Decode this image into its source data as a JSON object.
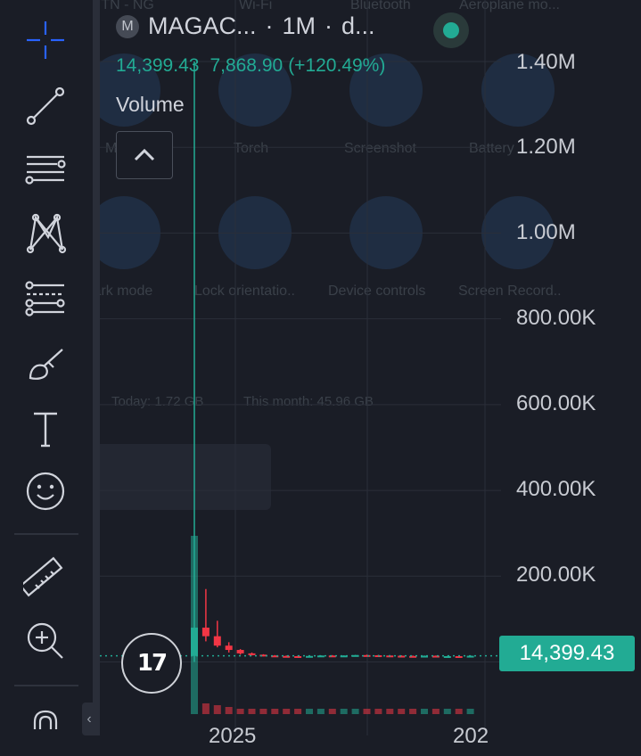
{
  "symbol_badge": "M",
  "title": {
    "symbol": "MAGAC...",
    "interval": "1M",
    "exchange": "d..."
  },
  "ohlc": {
    "last": "14,399.43",
    "change": "7,868.90",
    "change_pct": "(+120.49%)"
  },
  "volume_label": "Volume",
  "collapse_icon": "chevron-up",
  "tools": [
    "crosshair-icon",
    "trend-line-icon",
    "horizontal-lines-icon",
    "pattern-icon",
    "fib-tools-icon",
    "brush-icon",
    "text-icon",
    "emoji-icon",
    "ruler-icon",
    "zoom-in-icon",
    "lock-icon"
  ],
  "colors": {
    "up": "#22ab94",
    "down": "#f23645",
    "background": "#1a1d26",
    "axis_text": "#c8cbd2"
  },
  "price_tag": "14,399.43",
  "logo_text": "17",
  "x_axis_partial": [
    "2025",
    "202"
  ],
  "overlay_text": {
    "top_row": [
      "MTN - NG",
      "Wi-Fi",
      "Bluetooth",
      "Aeroplane mo..."
    ],
    "row1": [
      "Mute",
      "Torch",
      "Screenshot",
      "Battery"
    ],
    "row2": [
      "Dark mode",
      "Lock orientatio..",
      "Device controls",
      "Screen Record.."
    ],
    "usage": [
      "Today: 1.72 GB",
      "This month: 45.96 GB"
    ]
  },
  "chart_data": {
    "type": "candlestick",
    "y_axis": {
      "labels": [
        "1.40M",
        "1.20M",
        "1.00M",
        "800.00K",
        "600.00K",
        "400.00K",
        "200.00K"
      ],
      "ylim": [
        0,
        1400000
      ]
    },
    "last_price": 14399.43,
    "candles": [
      {
        "o": 14000,
        "h": 1400000,
        "l": 0,
        "c": 80000
      },
      {
        "o": 80000,
        "h": 170000,
        "l": 48000,
        "c": 60000
      },
      {
        "o": 60000,
        "h": 96000,
        "l": 34000,
        "c": 38000
      },
      {
        "o": 38000,
        "h": 46000,
        "l": 22000,
        "c": 28000
      },
      {
        "o": 28000,
        "h": 30000,
        "l": 17000,
        "c": 20000
      },
      {
        "o": 20000,
        "h": 22000,
        "l": 15000,
        "c": 17000
      },
      {
        "o": 17000,
        "h": 18000,
        "l": 13000,
        "c": 15000
      },
      {
        "o": 15000,
        "h": 16000,
        "l": 12500,
        "c": 14000
      },
      {
        "o": 14000,
        "h": 15000,
        "l": 12500,
        "c": 13500
      },
      {
        "o": 13500,
        "h": 14500,
        "l": 12500,
        "c": 13000
      },
      {
        "o": 13000,
        "h": 14500,
        "l": 12500,
        "c": 14000
      },
      {
        "o": 14000,
        "h": 15500,
        "l": 13000,
        "c": 15000
      },
      {
        "o": 15000,
        "h": 16000,
        "l": 13500,
        "c": 14500
      },
      {
        "o": 14500,
        "h": 15500,
        "l": 13500,
        "c": 15000
      },
      {
        "o": 15000,
        "h": 16500,
        "l": 14000,
        "c": 16000
      },
      {
        "o": 16000,
        "h": 17000,
        "l": 14500,
        "c": 15500
      },
      {
        "o": 15500,
        "h": 16500,
        "l": 14000,
        "c": 15000
      },
      {
        "o": 15000,
        "h": 16000,
        "l": 14000,
        "c": 14500
      },
      {
        "o": 14500,
        "h": 15500,
        "l": 13500,
        "c": 14000
      },
      {
        "o": 14000,
        "h": 15000,
        "l": 13000,
        "c": 13500
      },
      {
        "o": 13500,
        "h": 15000,
        "l": 13000,
        "c": 14500
      },
      {
        "o": 14500,
        "h": 15000,
        "l": 12000,
        "c": 12800
      },
      {
        "o": 12800,
        "h": 14000,
        "l": 12000,
        "c": 13500
      },
      {
        "o": 13500,
        "h": 14500,
        "l": 12500,
        "c": 12800
      },
      {
        "o": 12800,
        "h": 15500,
        "l": 12500,
        "c": 14399
      }
    ],
    "volume": [
      1,
      0.06,
      0.05,
      0.04,
      0.03,
      0.03,
      0.03,
      0.03,
      0.03,
      0.03,
      0.03,
      0.03,
      0.03,
      0.03,
      0.03,
      0.03,
      0.03,
      0.03,
      0.03,
      0.03,
      0.03,
      0.03,
      0.03,
      0.03,
      0.03
    ]
  }
}
